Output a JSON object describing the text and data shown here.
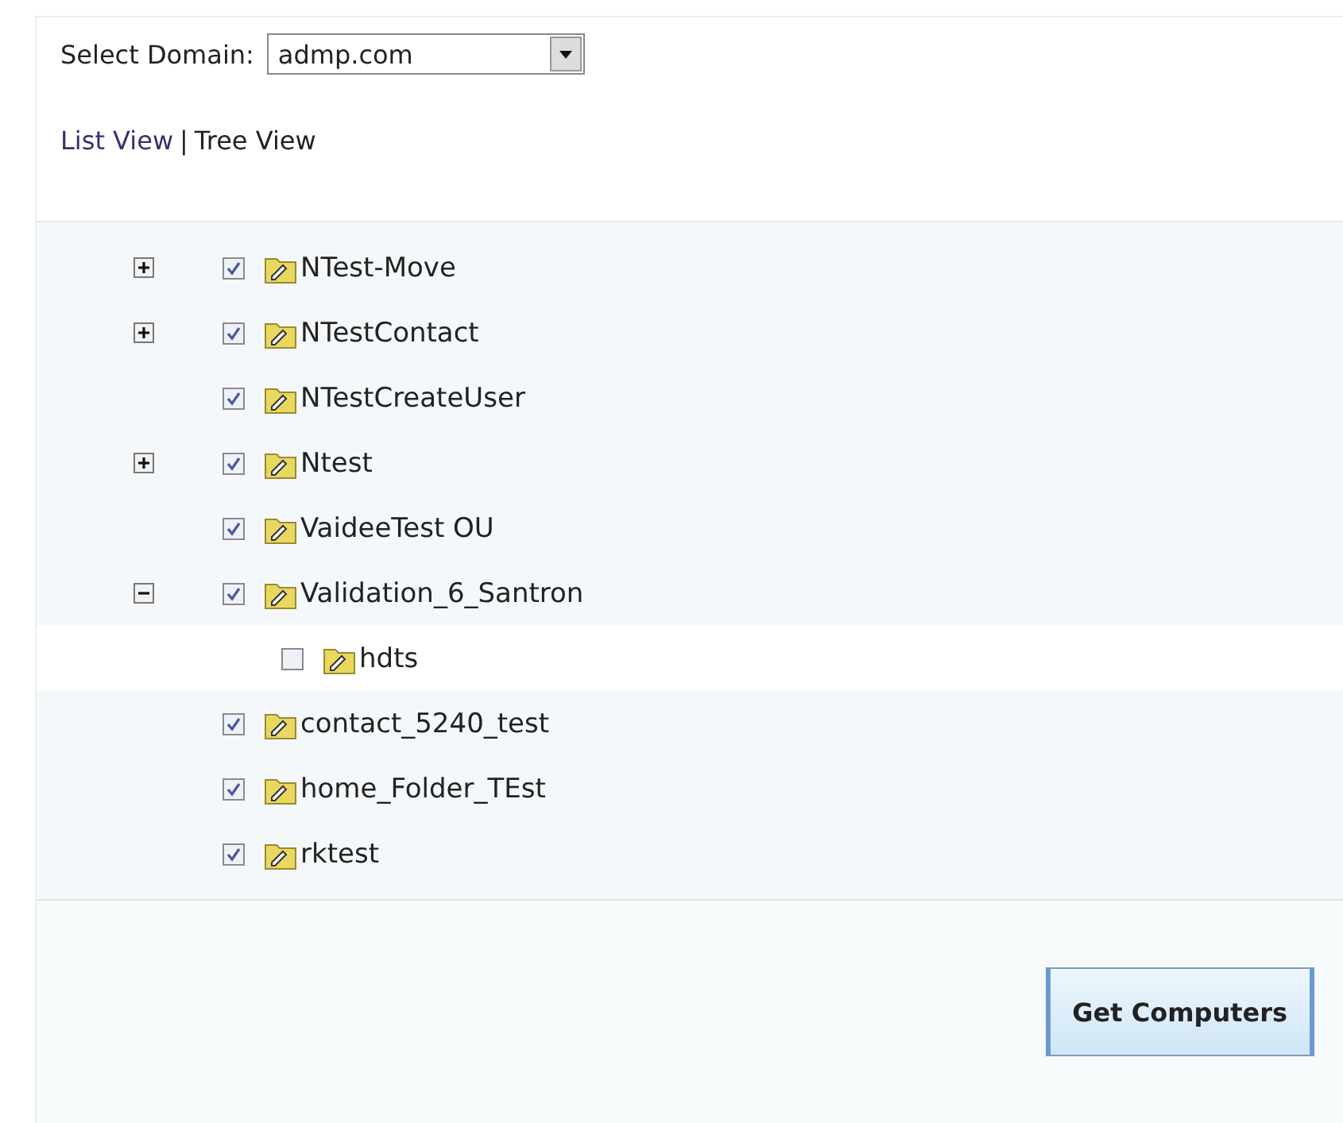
{
  "domain": {
    "label": "Select Domain:",
    "value": "admp.com"
  },
  "views": [
    {
      "label": "List View",
      "selected": false
    },
    {
      "label": "Tree View",
      "selected": true
    }
  ],
  "view_separator": "|",
  "tree": [
    {
      "name": "NTest-Move",
      "checked": true,
      "expanded": false
    },
    {
      "name": "NTestContact",
      "checked": true,
      "expanded": false
    },
    {
      "name": "NTestCreateUser",
      "checked": true
    },
    {
      "name": "Ntest",
      "checked": true,
      "expanded": false
    },
    {
      "name": "VaideeTest OU",
      "checked": true
    },
    {
      "name": "Validation_6_Santron",
      "checked": true,
      "expanded": true,
      "children": [
        {
          "name": "hdts",
          "checked": false
        }
      ]
    },
    {
      "name": "contact_5240_test",
      "checked": true
    },
    {
      "name": "home_Folder_TEst",
      "checked": true
    },
    {
      "name": "rktest",
      "checked": true
    }
  ],
  "button": "Get Computers"
}
